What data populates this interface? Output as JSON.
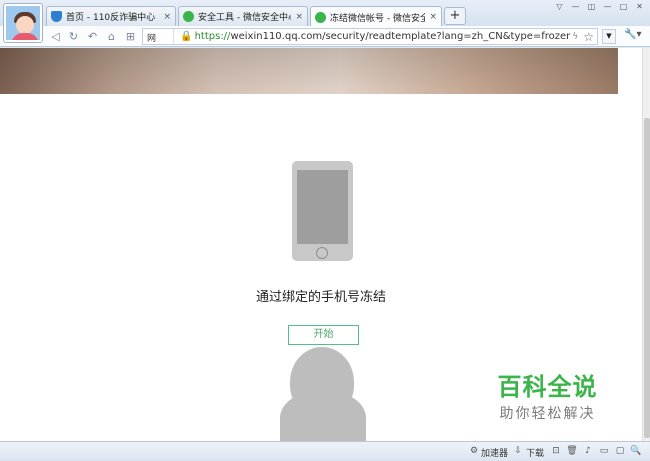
{
  "tabs": [
    {
      "label": "首页 - 110反诈骗中心",
      "icon": "shield-icon",
      "close": "×"
    },
    {
      "label": "安全工具 - 微信安全中心 -",
      "icon": "wechat-icon",
      "close": "×"
    },
    {
      "label": "冻结微信帐号 - 微信安全中",
      "icon": "wechat-icon",
      "close": "×",
      "active": true
    }
  ],
  "new_tab_label": "+",
  "window_controls": [
    "▽",
    "—",
    "◫",
    "—",
    "□",
    "✕"
  ],
  "toolbar": {
    "source_label": "腾讯网",
    "source_badge": "证",
    "url_scheme": "https://",
    "url_rest": "weixin110.qq.com/security/readtemplate?lang=zh_CN&type=frozer",
    "bolt": "ϟ",
    "star": "☆",
    "dropdown": "▼",
    "tools": "🔧▾"
  },
  "nav_icons": [
    "back-icon",
    "refresh-icon",
    "undo-icon",
    "home-icon",
    "grid-icon"
  ],
  "page": {
    "heading": "通过绑定的手机号冻结",
    "start_button": "开始"
  },
  "watermark": {
    "title": "百科全说",
    "subtitle": "助你轻松解决"
  },
  "status_bar": {
    "accelerator": "加速器",
    "download": "下载"
  },
  "colors": {
    "accent_green": "#4fc08d",
    "watermark_green": "#3bb54a",
    "secure_green": "#2e8b2e"
  }
}
